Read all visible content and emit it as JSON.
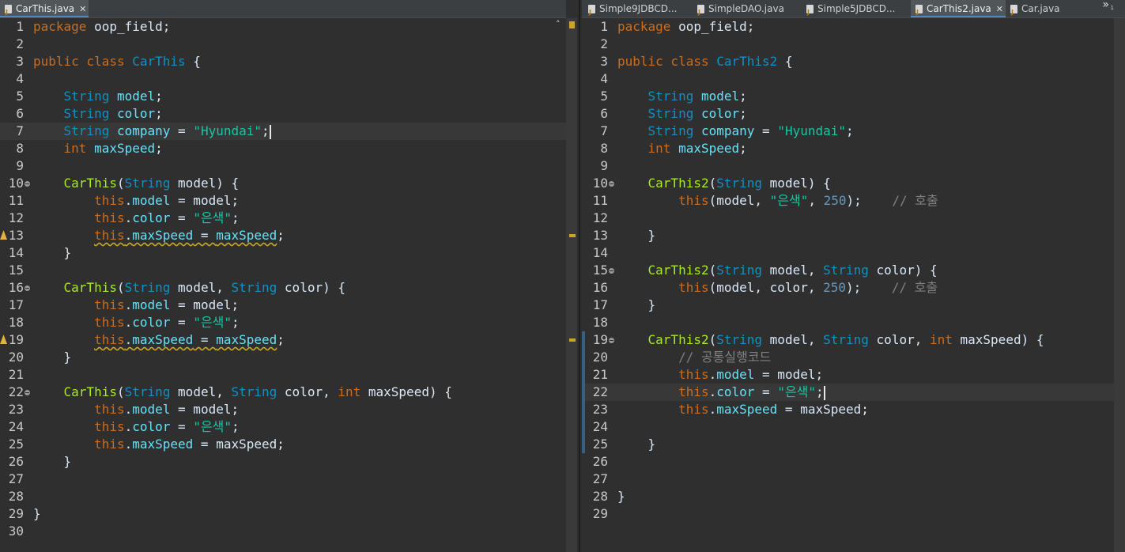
{
  "left": {
    "tab": {
      "title": "CarThis.java"
    },
    "lines": [
      {
        "n": "1",
        "t": [
          [
            "kw",
            "package"
          ],
          [
            "",
            "oop_field;"
          ]
        ]
      },
      {
        "n": "2",
        "t": []
      },
      {
        "n": "3",
        "t": [
          [
            "kw",
            "public class "
          ],
          [
            "typ",
            "CarThis"
          ],
          [
            "",
            " {"
          ]
        ]
      },
      {
        "n": "4",
        "t": []
      },
      {
        "n": "5",
        "t": [
          [
            "",
            "    "
          ],
          [
            "typ",
            "String "
          ],
          [
            "fld",
            "model"
          ],
          [
            "",
            ";"
          ]
        ]
      },
      {
        "n": "6",
        "t": [
          [
            "",
            "    "
          ],
          [
            "typ",
            "String "
          ],
          [
            "fld",
            "color"
          ],
          [
            "",
            ";"
          ]
        ]
      },
      {
        "n": "7",
        "t": [
          [
            "",
            "    "
          ],
          [
            "typ",
            "String "
          ],
          [
            "fld",
            "company"
          ],
          [
            "",
            " = "
          ],
          [
            "str",
            "\"Hyundai\""
          ],
          [
            "",
            ";"
          ]
        ]
      },
      {
        "n": "8",
        "t": [
          [
            "",
            "    "
          ],
          [
            "kw",
            "int "
          ],
          [
            "fld",
            "maxSpeed"
          ],
          [
            "",
            ";"
          ]
        ]
      },
      {
        "n": "9",
        "t": []
      },
      {
        "n": "10",
        "t": [
          [
            "",
            "    "
          ],
          [
            "ctor",
            "CarThis"
          ],
          [
            "",
            "("
          ],
          [
            "typ",
            "String "
          ],
          [
            "",
            "model) {"
          ]
        ]
      },
      {
        "n": "11",
        "t": [
          [
            "",
            "        "
          ],
          [
            "this",
            "this"
          ],
          [
            "",
            "."
          ],
          [
            "fld",
            "model"
          ],
          [
            "",
            " = model;"
          ]
        ]
      },
      {
        "n": "12",
        "t": [
          [
            "",
            "        "
          ],
          [
            "this",
            "this"
          ],
          [
            "",
            "."
          ],
          [
            "fld",
            "color"
          ],
          [
            "",
            " = "
          ],
          [
            "str",
            "\"은색\""
          ],
          [
            "",
            ";"
          ]
        ]
      },
      {
        "n": "13",
        "t": [
          [
            "",
            "        "
          ],
          [
            "this squig",
            "this"
          ],
          [
            "squig",
            "."
          ],
          [
            "fld squig",
            "maxSpeed"
          ],
          [
            "squig",
            " = "
          ],
          [
            "fld squig",
            "maxSpeed"
          ],
          [
            "",
            ";"
          ]
        ]
      },
      {
        "n": "14",
        "t": [
          [
            "",
            "    }"
          ]
        ]
      },
      {
        "n": "15",
        "t": []
      },
      {
        "n": "16",
        "t": [
          [
            "",
            "    "
          ],
          [
            "ctor",
            "CarThis"
          ],
          [
            "",
            "("
          ],
          [
            "typ",
            "String "
          ],
          [
            "",
            "model, "
          ],
          [
            "typ",
            "String "
          ],
          [
            "",
            "color) {"
          ]
        ]
      },
      {
        "n": "17",
        "t": [
          [
            "",
            "        "
          ],
          [
            "this",
            "this"
          ],
          [
            "",
            "."
          ],
          [
            "fld",
            "model"
          ],
          [
            "",
            " = model;"
          ]
        ]
      },
      {
        "n": "18",
        "t": [
          [
            "",
            "        "
          ],
          [
            "this",
            "this"
          ],
          [
            "",
            "."
          ],
          [
            "fld",
            "color"
          ],
          [
            "",
            " = "
          ],
          [
            "str",
            "\"은색\""
          ],
          [
            "",
            ";"
          ]
        ]
      },
      {
        "n": "19",
        "t": [
          [
            "",
            "        "
          ],
          [
            "this squig",
            "this"
          ],
          [
            "squig",
            "."
          ],
          [
            "fld squig",
            "maxSpeed"
          ],
          [
            "squig",
            " = "
          ],
          [
            "fld squig",
            "maxSpeed"
          ],
          [
            "",
            ";"
          ]
        ]
      },
      {
        "n": "20",
        "t": [
          [
            "",
            "    }"
          ]
        ]
      },
      {
        "n": "21",
        "t": []
      },
      {
        "n": "22",
        "t": [
          [
            "",
            "    "
          ],
          [
            "ctor",
            "CarThis"
          ],
          [
            "",
            "("
          ],
          [
            "typ",
            "String "
          ],
          [
            "",
            "model, "
          ],
          [
            "typ",
            "String "
          ],
          [
            "",
            "color, "
          ],
          [
            "kw",
            "int "
          ],
          [
            "",
            "maxSpeed) {"
          ]
        ]
      },
      {
        "n": "23",
        "t": [
          [
            "",
            "        "
          ],
          [
            "this",
            "this"
          ],
          [
            "",
            "."
          ],
          [
            "fld",
            "model"
          ],
          [
            "",
            " = model;"
          ]
        ]
      },
      {
        "n": "24",
        "t": [
          [
            "",
            "        "
          ],
          [
            "this",
            "this"
          ],
          [
            "",
            "."
          ],
          [
            "fld",
            "color"
          ],
          [
            "",
            " = "
          ],
          [
            "str",
            "\"은색\""
          ],
          [
            "",
            ";"
          ]
        ]
      },
      {
        "n": "25",
        "t": [
          [
            "",
            "        "
          ],
          [
            "this",
            "this"
          ],
          [
            "",
            "."
          ],
          [
            "fld",
            "maxSpeed"
          ],
          [
            "",
            " = maxSpeed;"
          ]
        ]
      },
      {
        "n": "26",
        "t": [
          [
            "",
            "    }"
          ]
        ]
      },
      {
        "n": "27",
        "t": []
      },
      {
        "n": "28",
        "t": []
      },
      {
        "n": "29",
        "t": [
          [
            "",
            "}"
          ]
        ]
      },
      {
        "n": "30",
        "t": []
      }
    ]
  },
  "right": {
    "tabs": [
      {
        "title": "Simple9JDBCD...",
        "active": false
      },
      {
        "title": "SimpleDAO.java",
        "active": false
      },
      {
        "title": "Simple5JDBCD...",
        "active": false
      },
      {
        "title": "CarThis2.java",
        "active": true
      },
      {
        "title": "Car.java",
        "active": false
      }
    ],
    "overflow_label": "»",
    "overflow_count": "1",
    "lines": [
      {
        "n": "1",
        "t": [
          [
            "kw",
            "package"
          ],
          [
            "",
            "oop_field;"
          ]
        ]
      },
      {
        "n": "2",
        "t": []
      },
      {
        "n": "3",
        "t": [
          [
            "kw",
            "public class "
          ],
          [
            "typ",
            "CarThis2"
          ],
          [
            "",
            " {"
          ]
        ]
      },
      {
        "n": "4",
        "t": []
      },
      {
        "n": "5",
        "t": [
          [
            "",
            "    "
          ],
          [
            "typ",
            "String "
          ],
          [
            "fld",
            "model"
          ],
          [
            "",
            ";"
          ]
        ]
      },
      {
        "n": "6",
        "t": [
          [
            "",
            "    "
          ],
          [
            "typ",
            "String "
          ],
          [
            "fld",
            "color"
          ],
          [
            "",
            ";"
          ]
        ]
      },
      {
        "n": "7",
        "t": [
          [
            "",
            "    "
          ],
          [
            "typ",
            "String "
          ],
          [
            "fld",
            "company"
          ],
          [
            "",
            " = "
          ],
          [
            "str",
            "\"Hyundai\""
          ],
          [
            "",
            ";"
          ]
        ]
      },
      {
        "n": "8",
        "t": [
          [
            "",
            "    "
          ],
          [
            "kw",
            "int "
          ],
          [
            "fld",
            "maxSpeed"
          ],
          [
            "",
            ";"
          ]
        ]
      },
      {
        "n": "9",
        "t": []
      },
      {
        "n": "10",
        "t": [
          [
            "",
            "    "
          ],
          [
            "ctor",
            "CarThis2"
          ],
          [
            "",
            "("
          ],
          [
            "typ",
            "String "
          ],
          [
            "",
            "model) {"
          ]
        ]
      },
      {
        "n": "11",
        "t": [
          [
            "",
            "        "
          ],
          [
            "this",
            "this"
          ],
          [
            "",
            "(model, "
          ],
          [
            "str",
            "\"은색\""
          ],
          [
            "",
            ", "
          ],
          [
            "num",
            "250"
          ],
          [
            "",
            ");    "
          ],
          [
            "cmt",
            "// 호출"
          ]
        ]
      },
      {
        "n": "12",
        "t": []
      },
      {
        "n": "13",
        "t": [
          [
            "",
            "    }"
          ]
        ]
      },
      {
        "n": "14",
        "t": []
      },
      {
        "n": "15",
        "t": [
          [
            "",
            "    "
          ],
          [
            "ctor",
            "CarThis2"
          ],
          [
            "",
            "("
          ],
          [
            "typ",
            "String "
          ],
          [
            "",
            "model, "
          ],
          [
            "typ",
            "String "
          ],
          [
            "",
            "color) {"
          ]
        ]
      },
      {
        "n": "16",
        "t": [
          [
            "",
            "        "
          ],
          [
            "this",
            "this"
          ],
          [
            "",
            "(model, color, "
          ],
          [
            "num",
            "250"
          ],
          [
            "",
            ");    "
          ],
          [
            "cmt",
            "// 호출"
          ]
        ]
      },
      {
        "n": "17",
        "t": [
          [
            "",
            "    }"
          ]
        ]
      },
      {
        "n": "18",
        "t": []
      },
      {
        "n": "19",
        "t": [
          [
            "",
            "    "
          ],
          [
            "ctor",
            "CarThis2"
          ],
          [
            "",
            "("
          ],
          [
            "typ",
            "String "
          ],
          [
            "",
            "model, "
          ],
          [
            "typ",
            "String "
          ],
          [
            "",
            "color, "
          ],
          [
            "kw",
            "int "
          ],
          [
            "",
            "maxSpeed) {"
          ]
        ]
      },
      {
        "n": "20",
        "t": [
          [
            "",
            "        "
          ],
          [
            "cmt",
            "// 공통실행코드"
          ]
        ]
      },
      {
        "n": "21",
        "t": [
          [
            "",
            "        "
          ],
          [
            "this",
            "this"
          ],
          [
            "",
            "."
          ],
          [
            "fld",
            "model"
          ],
          [
            "",
            " = model;"
          ]
        ]
      },
      {
        "n": "22",
        "t": [
          [
            "",
            "        "
          ],
          [
            "this",
            "this"
          ],
          [
            "",
            "."
          ],
          [
            "fld",
            "color"
          ],
          [
            "",
            " = "
          ],
          [
            "str",
            "\"은색\""
          ],
          [
            "",
            ";"
          ]
        ]
      },
      {
        "n": "23",
        "t": [
          [
            "",
            "        "
          ],
          [
            "this",
            "this"
          ],
          [
            "",
            "."
          ],
          [
            "fld",
            "maxSpeed"
          ],
          [
            "",
            " = maxSpeed;"
          ]
        ]
      },
      {
        "n": "24",
        "t": []
      },
      {
        "n": "25",
        "t": [
          [
            "",
            "    }"
          ]
        ]
      },
      {
        "n": "26",
        "t": []
      },
      {
        "n": "27",
        "t": []
      },
      {
        "n": "28",
        "t": [
          [
            "",
            "}"
          ]
        ]
      },
      {
        "n": "29",
        "t": []
      }
    ]
  },
  "colors": {
    "background": "#2f2f2f",
    "keyword": "#cc6c1d",
    "type": "#1290c3",
    "field": "#66e1f8",
    "string": "#17c6a3",
    "constructor": "#a7ec21",
    "comment": "#808080"
  }
}
